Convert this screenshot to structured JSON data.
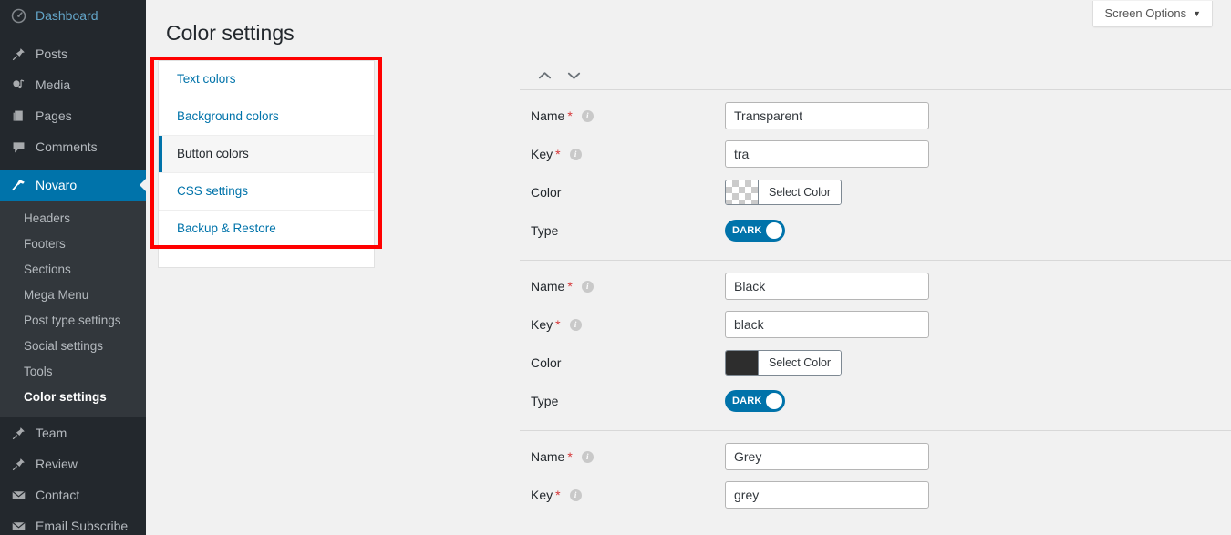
{
  "sidebar": {
    "top_items": [
      {
        "label": "Dashboard",
        "icon": "dashboard-icon",
        "style": "dash"
      },
      {
        "label": "Posts",
        "icon": "pin-icon",
        "style": ""
      },
      {
        "label": "Media",
        "icon": "media-icon",
        "style": ""
      },
      {
        "label": "Pages",
        "icon": "pages-icon",
        "style": ""
      },
      {
        "label": "Comments",
        "icon": "comment-icon",
        "style": ""
      }
    ],
    "current_item": {
      "label": "Novaro",
      "icon": "hammer-icon"
    },
    "submenu": [
      {
        "label": "Headers",
        "active": false
      },
      {
        "label": "Footers",
        "active": false
      },
      {
        "label": "Sections",
        "active": false
      },
      {
        "label": "Mega Menu",
        "active": false
      },
      {
        "label": "Post type settings",
        "active": false
      },
      {
        "label": "Social settings",
        "active": false
      },
      {
        "label": "Tools",
        "active": false
      },
      {
        "label": "Color settings",
        "active": true
      }
    ],
    "bottom_items": [
      {
        "label": "Team",
        "icon": "pin-icon"
      },
      {
        "label": "Review",
        "icon": "pin-icon"
      },
      {
        "label": "Contact",
        "icon": "envelope-icon"
      },
      {
        "label": "Email Subscribe",
        "icon": "envelope-icon"
      }
    ]
  },
  "header": {
    "screen_options_label": "Screen Options",
    "screen_options_caret": "▼",
    "page_title": "Color settings"
  },
  "tabs": [
    {
      "label": "Text colors",
      "active": false
    },
    {
      "label": "Background colors",
      "active": false
    },
    {
      "label": "Button colors",
      "active": true
    },
    {
      "label": "CSS settings",
      "active": false
    },
    {
      "label": "Backup & Restore",
      "active": false
    }
  ],
  "labels": {
    "name": "Name",
    "key": "Key",
    "color": "Color",
    "type": "Type",
    "required_mark": "*",
    "info_glyph": "i",
    "select_color": "Select Color",
    "move_up": "move-up",
    "move_down": "move-down"
  },
  "colors": {
    "accent": "#0073aa",
    "sidebar_bg": "#23282d",
    "submenu_bg": "#32373c",
    "page_bg": "#f1f1f1",
    "highlight_box": "#ff0000",
    "required": "#d63638"
  },
  "rows": [
    {
      "name_value": "Transparent",
      "key_value": "tra",
      "swatch_type": "checker",
      "swatch_color": "transparent",
      "toggle_label": "DARK",
      "toggle_on": true
    },
    {
      "name_value": "Black",
      "key_value": "black",
      "swatch_type": "solid",
      "swatch_color": "#2d2d2d",
      "toggle_label": "DARK",
      "toggle_on": true
    },
    {
      "name_value": "Grey",
      "key_value": "grey",
      "swatch_type": "none",
      "swatch_color": "",
      "toggle_label": "",
      "toggle_on": false
    }
  ]
}
